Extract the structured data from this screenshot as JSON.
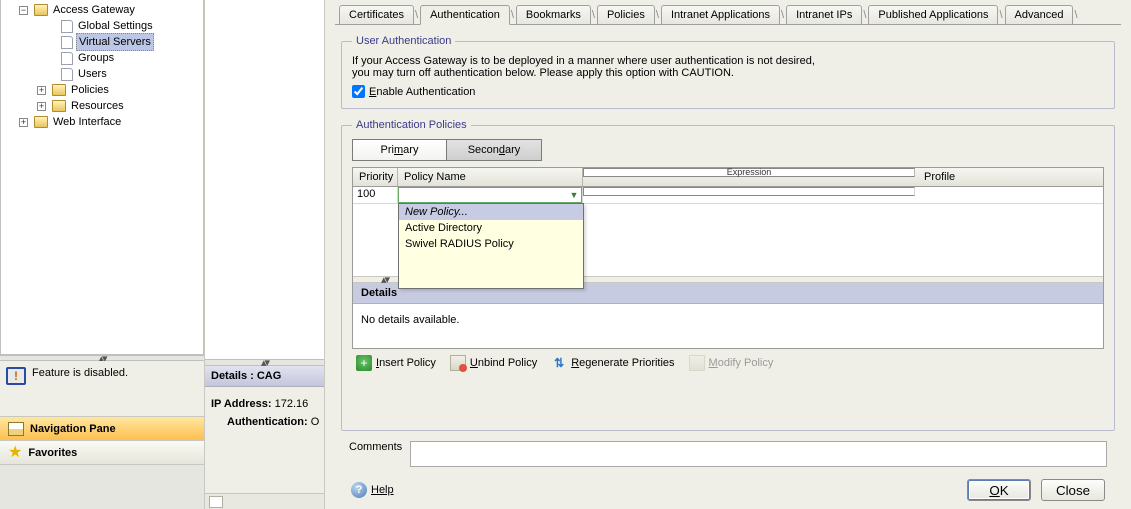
{
  "tree": {
    "root": "Access Gateway",
    "items": {
      "global": "Global Settings",
      "vs": "Virtual Servers",
      "groups": "Groups",
      "users": "Users",
      "policies": "Policies",
      "resources": "Resources"
    },
    "web": "Web Interface"
  },
  "left": {
    "status": "Feature is disabled.",
    "nav_pane": "Navigation Pane",
    "favorites": "Favorites"
  },
  "mid": {
    "header": "Details : CAG",
    "ip_label": "IP Address:",
    "ip_value": "172.16",
    "auth_label": "Authentication:",
    "auth_value": "O"
  },
  "tabs": {
    "certificates": "Certificates",
    "authentication": "Authentication",
    "bookmarks": "Bookmarks",
    "policies": "Policies",
    "intranet_apps": "Intranet Applications",
    "intranet_ips": "Intranet IPs",
    "published_apps": "Published Applications",
    "advanced": "Advanced"
  },
  "user_auth": {
    "legend": "User Authentication",
    "line1": "If your Access Gateway is to be deployed in a manner where user authentication is not desired,",
    "line2": "you may turn off authentication below. Please apply this option with CAUTION.",
    "enable": "Enable Authentication"
  },
  "auth_pol": {
    "legend": "Authentication Policies",
    "primary": "Primary",
    "secondary": "Secondary",
    "cols": {
      "priority": "Priority",
      "policy": "Policy Name",
      "expression": "Expression",
      "profile": "Profile"
    },
    "row": {
      "priority": "100"
    },
    "dropdown": {
      "new": "New Policy...",
      "ad": "Active Directory",
      "swivel": "Swivel RADIUS Policy"
    },
    "details": "Details",
    "nodetails": "No details available."
  },
  "tools": {
    "insert": "Insert Policy",
    "unbind": "Unbind Policy",
    "regen": "Regenerate Priorities",
    "modify": "Modify Policy"
  },
  "comments": {
    "label": "Comments"
  },
  "bottom": {
    "help": "Help",
    "ok": "OK",
    "close": "Close"
  }
}
